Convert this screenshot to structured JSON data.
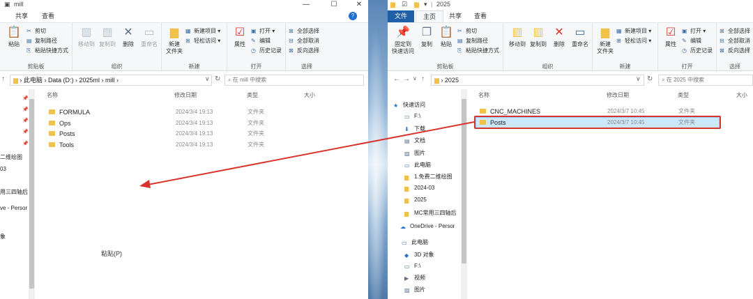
{
  "left_window": {
    "title": "mill",
    "controls": {
      "minimize": "—",
      "maximize": "☐",
      "close": "✕"
    },
    "tabs": [
      "共享",
      "查看"
    ],
    "ribbon": {
      "clipboard": {
        "label": "剪贴板",
        "paste": "粘贴",
        "cut": "剪切",
        "copy_path": "复制路径",
        "paste_shortcut": "粘贴快捷方式"
      },
      "organize": {
        "label": "组织",
        "move_to": "移动到",
        "copy_to": "复制到",
        "delete": "删除",
        "rename": "重命名"
      },
      "new": {
        "label": "新建",
        "new_folder": "新建\n文件夹",
        "new_item": "新建项目 ▾",
        "easy_access": "轻松访问 ▾"
      },
      "open": {
        "label": "打开",
        "properties": "属性",
        "open": "打开 ▾",
        "edit": "编辑",
        "history": "历史记录"
      },
      "select": {
        "label": "选择",
        "select_all": "全部选择",
        "select_none": "全部取消",
        "invert": "反向选择"
      }
    },
    "breadcrumb": [
      "此电脑",
      "Data (D:)",
      "2025ml",
      "mill"
    ],
    "search_placeholder": "在 mill 中搜索",
    "columns": {
      "name": "名称",
      "date": "修改日期",
      "type": "类型",
      "size": "大小"
    },
    "files": [
      {
        "name": "FORMULA",
        "date": "2024/3/4 19:13",
        "type": "文件夹"
      },
      {
        "name": "Ops",
        "date": "2024/3/4 19:13",
        "type": "文件夹"
      },
      {
        "name": "Posts",
        "date": "2024/3/4 19:13",
        "type": "文件夹"
      },
      {
        "name": "Tools",
        "date": "2024/3/4 19:13",
        "type": "文件夹"
      }
    ],
    "nav_partial": [
      "二维绘图",
      "03",
      "用三四轴后",
      "ve - Persor",
      "象"
    ],
    "context_hint": "粘贴(P)"
  },
  "right_window": {
    "title": "2025",
    "controls": {
      "collapse": "∨",
      "help": "?"
    },
    "tabs": {
      "file": "文件",
      "home": "主页",
      "share": "共享",
      "view": "查看"
    },
    "ribbon": {
      "clipboard": {
        "label": "剪贴板",
        "pin": "固定到\n快速访问",
        "copy": "复制",
        "paste": "粘贴",
        "cut": "剪切",
        "copy_path": "复制路径",
        "paste_shortcut": "粘贴快捷方式"
      },
      "organize": {
        "label": "组织",
        "move_to": "移动到",
        "copy_to": "复制到",
        "delete": "删除",
        "rename": "重命名"
      },
      "new": {
        "label": "新建",
        "new_folder": "新建\n文件夹",
        "new_item": "新建项目 ▾",
        "easy_access": "轻松访问 ▾"
      },
      "open": {
        "label": "打开",
        "properties": "属性",
        "open": "打开 ▾",
        "edit": "编辑",
        "history": "历史记录"
      },
      "select": {
        "label": "选择",
        "select_all": "全部选择",
        "select_none": "全部取消",
        "invert": "反向选择"
      }
    },
    "breadcrumb": [
      "2025"
    ],
    "search_placeholder": "在 2025 中搜索",
    "columns": {
      "name": "名称",
      "date": "修改日期",
      "type": "类型",
      "size": "大小"
    },
    "files": [
      {
        "name": "CNC_MACHINES",
        "date": "2024/3/7 10:45",
        "type": "文件夹"
      },
      {
        "name": "Posts",
        "date": "2024/3/7 10:45",
        "type": "文件夹"
      }
    ],
    "nav": {
      "quick_access": "快速访问",
      "items": [
        "F:\\",
        "下载",
        "文档",
        "图片",
        "此电脑",
        "1.免费二维绘图",
        "2024-03",
        "2025",
        "MC常用三四轴后"
      ],
      "onedrive": "OneDrive - Persor",
      "this_pc": "此电脑",
      "pc_items": [
        "3D 对象",
        "F:\\",
        "视频",
        "图片"
      ]
    }
  },
  "colors": {
    "accent": "#1f5fa8",
    "annotation": "#d9342b",
    "selection": "#cce8ff"
  }
}
